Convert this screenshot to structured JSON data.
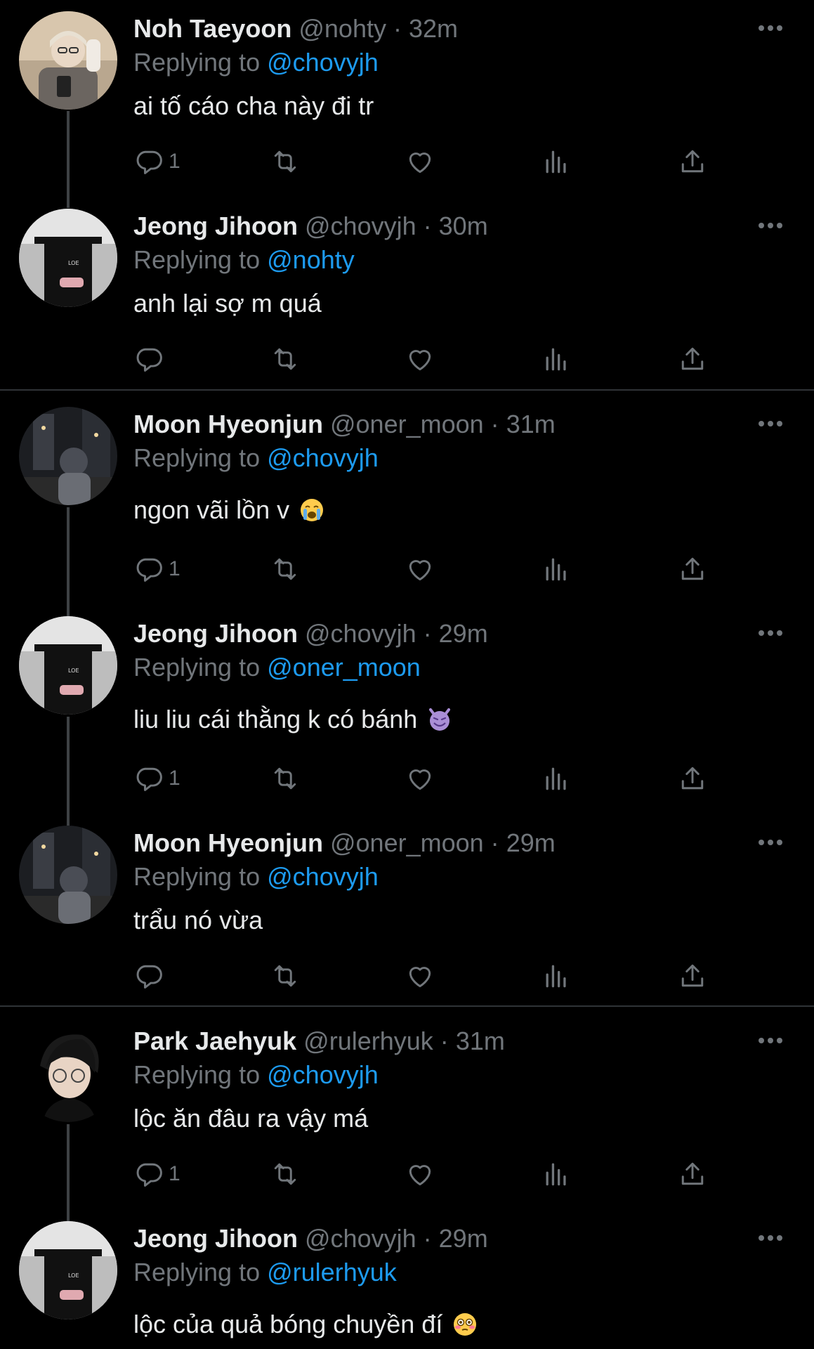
{
  "tweets": [
    {
      "name": "Noh Taeyoon",
      "handle": "@nohty",
      "dot": "·",
      "time": "32m",
      "replying_label": "Replying to",
      "replying_to": "@chovyjh",
      "text": "ai tố cáo cha này đi tr",
      "emoji": "",
      "reply_count": "1",
      "avatar": "blonde-boy-mirror-selfie"
    },
    {
      "name": "Jeong Jihoon",
      "handle": "@chovyjh",
      "dot": "·",
      "time": "30m",
      "replying_label": "Replying to",
      "replying_to": "@nohty",
      "text": "anh lại sợ m quá",
      "emoji": "",
      "reply_count": "",
      "avatar": "man-black-shirt-phone"
    },
    {
      "name": "Moon Hyeonjun",
      "handle": "@oner_moon",
      "dot": "·",
      "time": "31m",
      "replying_label": "Replying to",
      "replying_to": "@chovyjh",
      "text": "ngon vãi lồn v",
      "emoji": "loudly-crying-face-emoji",
      "reply_count": "1",
      "avatar": "night-street-cap"
    },
    {
      "name": "Jeong Jihoon",
      "handle": "@chovyjh",
      "dot": "·",
      "time": "29m",
      "replying_label": "Replying to",
      "replying_to": "@oner_moon",
      "text": "liu liu cái thằng k có bánh",
      "emoji": "smiling-imp-emoji",
      "reply_count": "1",
      "avatar": "man-black-shirt-phone"
    },
    {
      "name": "Moon Hyeonjun",
      "handle": "@oner_moon",
      "dot": "·",
      "time": "29m",
      "replying_label": "Replying to",
      "replying_to": "@chovyjh",
      "text": "trẩu nó vừa",
      "emoji": "",
      "reply_count": "",
      "avatar": "night-street-cap"
    },
    {
      "name": "Park Jaehyuk",
      "handle": "@rulerhyuk",
      "dot": "·",
      "time": "31m",
      "replying_label": "Replying to",
      "replying_to": "@chovyjh",
      "text": "lộc ăn đâu ra vậy má",
      "emoji": "",
      "reply_count": "1",
      "avatar": "boy-glasses-dark"
    },
    {
      "name": "Jeong Jihoon",
      "handle": "@chovyjh",
      "dot": "·",
      "time": "29m",
      "replying_label": "Replying to",
      "replying_to": "@rulerhyuk",
      "text": "lộc của quả bóng chuyền đí",
      "emoji": "flushed-face-emoji",
      "reply_count": "",
      "avatar": "man-black-shirt-phone"
    }
  ],
  "theme": {
    "background": "#000000",
    "text": "#e7e9ea",
    "muted": "#71767b",
    "link": "#1d9bf0",
    "divider": "#2f3336"
  }
}
